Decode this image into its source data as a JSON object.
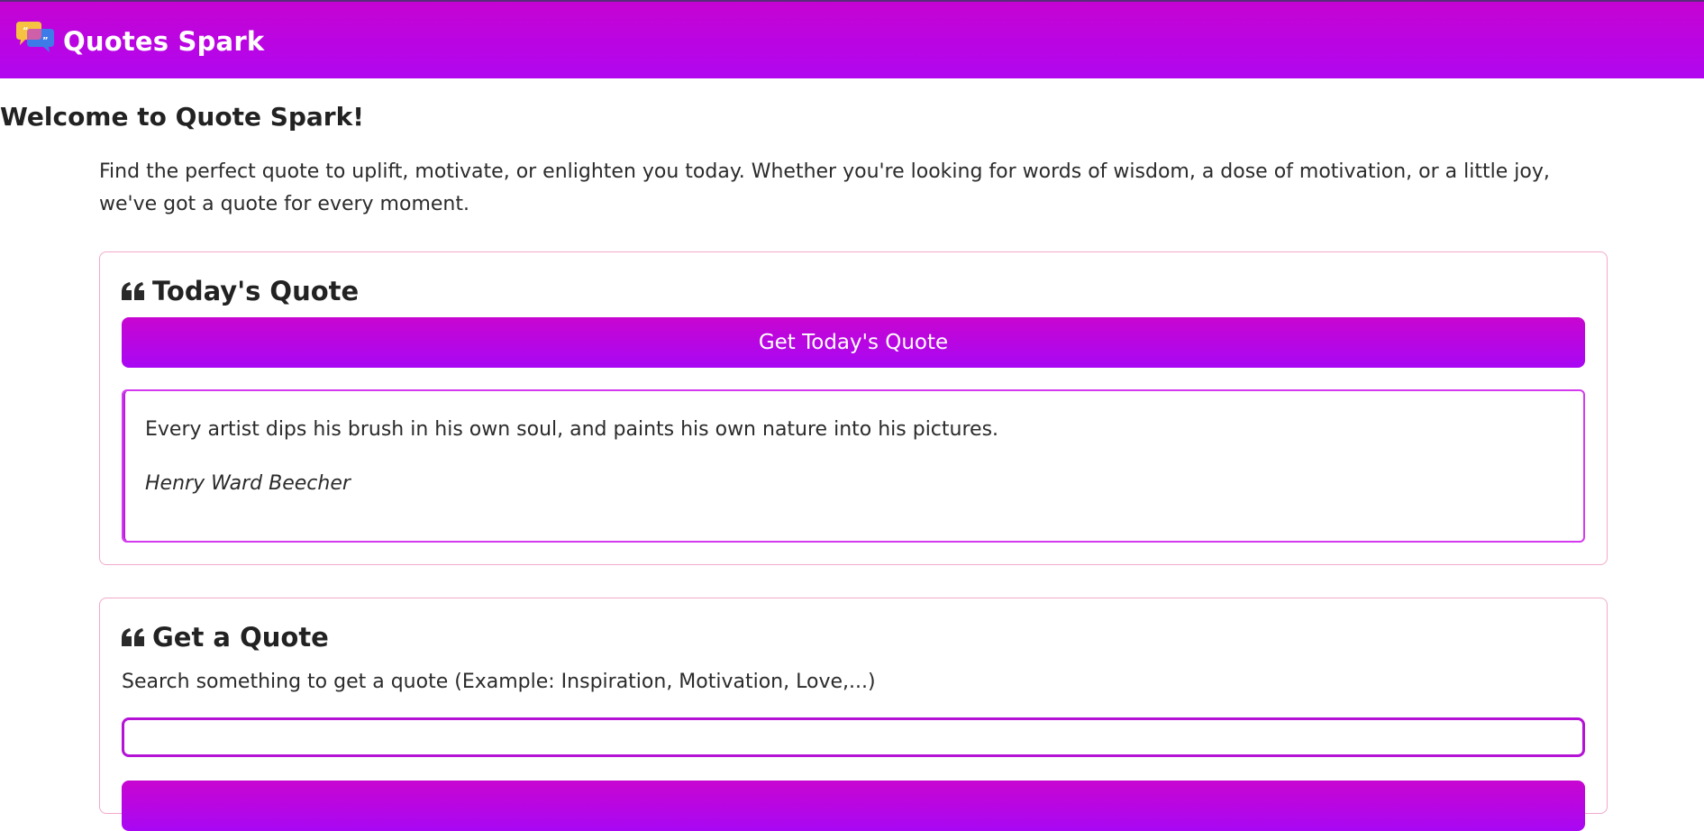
{
  "header": {
    "brand": "Quotes Spark",
    "logo_icon": "speech-bubbles-icon",
    "gradient_top": "#c504d2",
    "gradient_bottom": "#b106f0"
  },
  "welcome": {
    "title": "Welcome to Quote Spark!",
    "intro": "Find the perfect quote to uplift, motivate, or enlighten you today. Whether you're looking for words of wisdom, a dose of motivation, or a little joy, we've got a quote for every moment."
  },
  "today_card": {
    "icon": "quote-left-icon",
    "title": "Today's Quote",
    "button_label": "Get Today's Quote",
    "quote": {
      "text": "Every artist dips his brush in his own soul, and paints his own nature into his pictures.",
      "author": "Henry Ward Beecher"
    }
  },
  "search_card": {
    "icon": "quote-left-icon",
    "title": "Get a Quote",
    "hint": "Search something to get a quote (Example: Inspiration, Motivation, Love,...)",
    "input_value": "",
    "input_placeholder": ""
  },
  "colors": {
    "accent": "#b106f0",
    "card_border": "#f2a9c9",
    "quote_border": "#d43bef"
  }
}
